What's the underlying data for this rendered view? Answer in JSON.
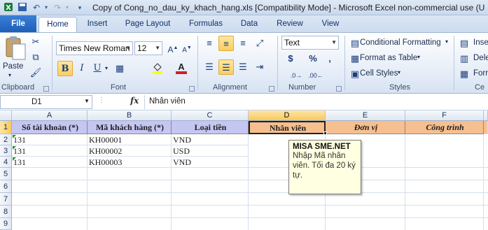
{
  "window": {
    "title": "Copy of Cong_no_dau_ky_khach_hang.xls  [Compatibility Mode]  -  Microsoft Excel non-commercial use (U"
  },
  "tabs": [
    "File",
    "Home",
    "Insert",
    "Page Layout",
    "Formulas",
    "Data",
    "Review",
    "View"
  ],
  "ribbon": {
    "clipboard": {
      "paste_label": "Paste",
      "group_label": "Clipboard"
    },
    "font": {
      "name": "Times New Roman",
      "size": "12",
      "bold_label": "B",
      "italic_label": "I",
      "underline_label": "U",
      "font_color_label": "A",
      "group_label": "Font"
    },
    "alignment": {
      "group_label": "Alignment"
    },
    "number": {
      "format": "Text",
      "currency_label": "$",
      "percent_label": "%",
      "comma_label": ",",
      "group_label": "Number"
    },
    "styles": {
      "conditional_formatting": "Conditional Formatting",
      "format_as_table": "Format as Table",
      "cell_styles": "Cell Styles",
      "group_label": "Styles"
    },
    "cells": {
      "insert": "Inse",
      "delete": "Dele",
      "format": "Forr",
      "group_label": "Ce"
    }
  },
  "formula_bar": {
    "name_box": "D1",
    "fx": "fx",
    "content": "Nhân viên"
  },
  "grid": {
    "columns": [
      "A",
      "B",
      "C",
      "D",
      "E",
      "F"
    ],
    "selected_column": "D",
    "rows": [
      "1",
      "2",
      "3",
      "4",
      "5",
      "6",
      "7",
      "8",
      "9"
    ],
    "selected_row": "1",
    "header_row": [
      "Số tài khoản (*)",
      "Mã khách hàng (*)",
      "Loại tiền",
      "Nhân viên",
      "Đơn vị",
      "Công trình"
    ],
    "data": [
      [
        "131",
        "KH00001",
        "VND"
      ],
      [
        "131",
        "KH00002",
        "USD"
      ],
      [
        "131",
        "KH00003",
        "VND"
      ]
    ]
  },
  "comment": {
    "author": "MISA SME.NET",
    "text_lines": [
      "Nhập Mã nhân",
      "viên. Tối đa 20 ký",
      "tự."
    ]
  },
  "colors": {
    "header_blue": "#c5c6f2",
    "header_orange": "#f6bf8f",
    "comment_bg": "#ffffe1",
    "file_tab": "#2a6fc9"
  }
}
